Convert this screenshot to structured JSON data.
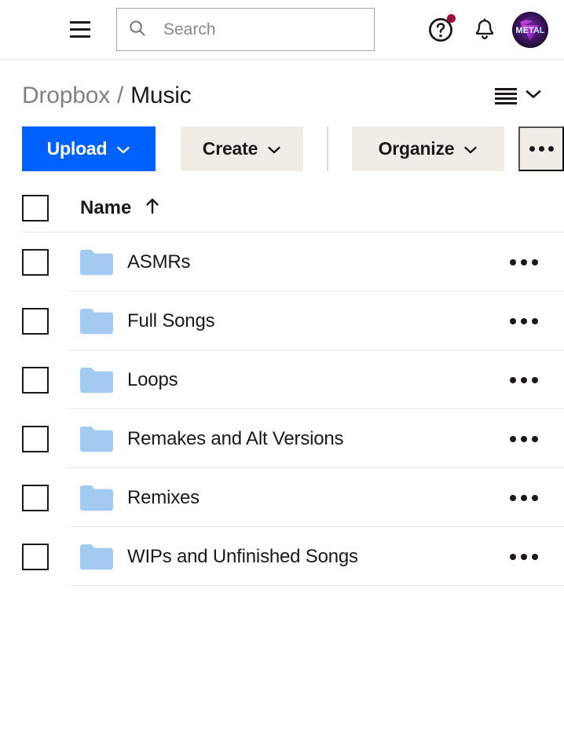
{
  "topbar": {
    "apps_icon": "grid-apps-icon",
    "menu_icon": "hamburger-menu-icon",
    "search": {
      "icon": "search-icon",
      "value": "",
      "placeholder": "Search"
    },
    "help_icon": "help-question-icon",
    "help_badge": true,
    "notifications_icon": "bell-icon",
    "avatar_label": "METAL"
  },
  "breadcrumb": {
    "root": "Dropbox",
    "separator": "/",
    "current": "Music",
    "view_icon": "list-view-icon",
    "view_chevron": "chevron-down-icon"
  },
  "toolbar": {
    "upload_label": "Upload",
    "create_label": "Create",
    "organize_label": "Organize",
    "more_label": "•••",
    "chevron": "chevron-down-icon"
  },
  "table": {
    "header": {
      "select_all": "select-all-checkbox",
      "name_label": "Name",
      "sort_icon": "↑",
      "sort_direction": "ascending"
    },
    "rows": [
      {
        "name": "ASMRs",
        "type": "folder"
      },
      {
        "name": "Full Songs",
        "type": "folder"
      },
      {
        "name": "Loops",
        "type": "folder"
      },
      {
        "name": "Remakes and Alt Versions",
        "type": "folder"
      },
      {
        "name": "Remixes",
        "type": "folder"
      },
      {
        "name": "WIPs and Unfinished Songs",
        "type": "folder"
      }
    ]
  },
  "colors": {
    "primary_blue": "#0061fe",
    "button_beige": "#f0ece6",
    "folder_blue": "#a3cbf1",
    "badge_red": "#9b0e3c",
    "text_dark": "#1e1919",
    "text_muted": "#84807a",
    "divider": "#ebe8e3"
  }
}
